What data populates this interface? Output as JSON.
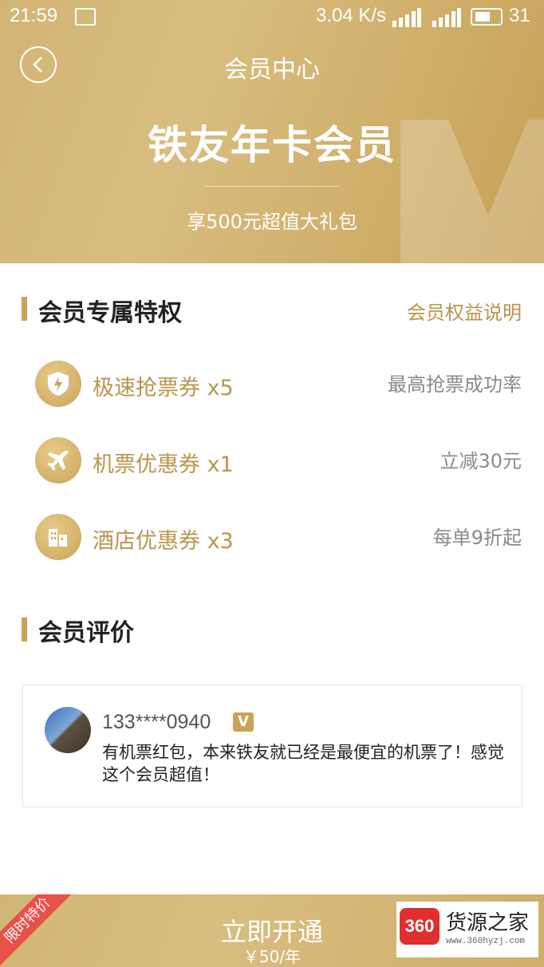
{
  "status_bar": {
    "time": "21:59",
    "net_speed": "3.04 K/s",
    "battery": "31"
  },
  "header": {
    "nav_title": "会员中心",
    "hero_title": "铁友年卡会员",
    "hero_subtitle": "享500元超值大礼包"
  },
  "privileges": {
    "title": "会员专属特权",
    "link": "会员权益说明",
    "items": [
      {
        "icon": "lightning-shield-icon",
        "name": "极速抢票券 x5",
        "desc": "最高抢票成功率"
      },
      {
        "icon": "airplane-icon",
        "name": "机票优惠券 x1",
        "desc": "立减30元"
      },
      {
        "icon": "building-icon",
        "name": "酒店优惠券 x3",
        "desc": "每单9折起"
      }
    ]
  },
  "reviews": {
    "title": "会员评价",
    "items": [
      {
        "user": "133****0940",
        "badge": "V",
        "text": "有机票红包，本来铁友就已经是最便宜的机票了！感觉这个会员超值！"
      }
    ]
  },
  "bottom": {
    "ribbon": "限时特价",
    "cta": "立即开通",
    "price": "￥50/年"
  },
  "watermark": {
    "logo": "360",
    "name": "货源之家",
    "url": "www.360hyzj.com"
  },
  "colors": {
    "gold": "#c9a356",
    "gold_text": "#b8964e",
    "ribbon_red": "#e8504a"
  }
}
